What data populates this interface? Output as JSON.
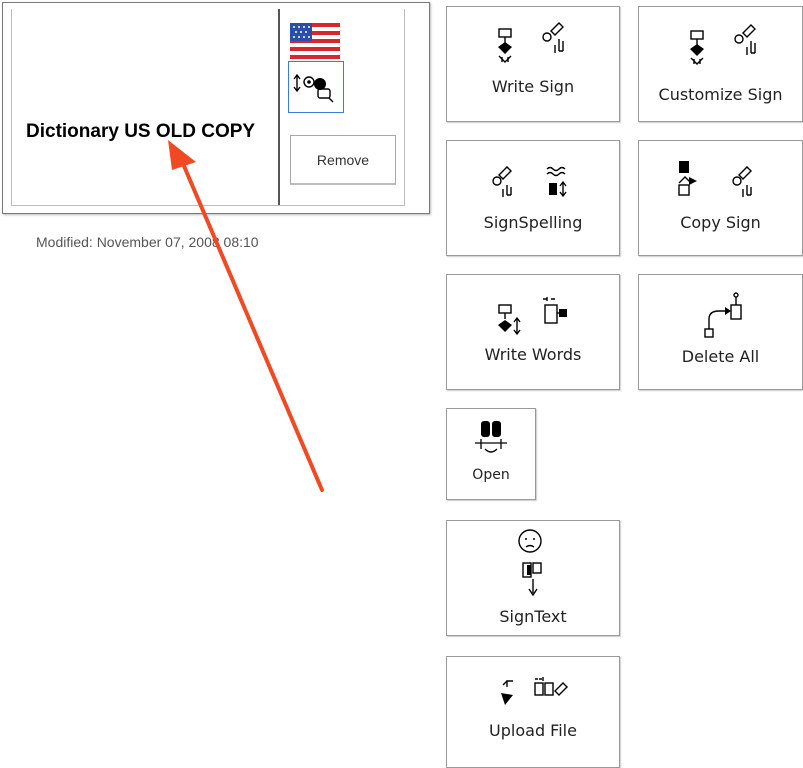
{
  "dictionary": {
    "title": "Dictionary US OLD COPY",
    "flag_icon": "us-flag-icon",
    "sign_icon": "sign-symbol-icon",
    "remove_label": "Remove",
    "modified": "Modified: November 07, 2008 08:10"
  },
  "tools": [
    {
      "label": "Write Sign",
      "icon": "write-sign-icon"
    },
    {
      "label": "Customize Sign",
      "icon": "customize-sign-icon"
    },
    {
      "label": "SignSpelling",
      "icon": "signspelling-icon"
    },
    {
      "label": "Copy Sign",
      "icon": "copy-sign-icon"
    },
    {
      "label": "Write Words",
      "icon": "write-words-icon"
    },
    {
      "label": "Delete All",
      "icon": "delete-all-icon"
    },
    {
      "label": "Open",
      "icon": "open-icon"
    },
    {
      "label": "SignText",
      "icon": "signtext-icon"
    },
    {
      "label": "Upload File",
      "icon": "upload-file-icon"
    }
  ],
  "colors": {
    "annotation_arrow": "#f04a24",
    "flag_red": "#d9262c",
    "flag_blue": "#2a4fa8",
    "selection_border": "#3b7be0"
  }
}
